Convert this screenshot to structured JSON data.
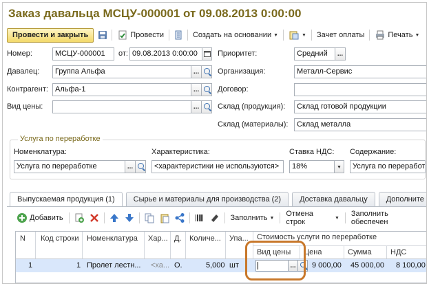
{
  "window": {
    "title": "Заказ давальца МСЦУ-000001 от 09.08.2013 0:00:00"
  },
  "toolbar": {
    "post_close": "Провести и закрыть",
    "post": "Провести",
    "create_based": "Создать на основании",
    "offset": "Зачет оплаты",
    "print": "Печать"
  },
  "form": {
    "number_label": "Номер:",
    "number_value": "МСЦУ-000001",
    "from_label": "от:",
    "date_value": "09.08.2013  0:00:00",
    "priority_label": "Приоритет:",
    "priority_value": "Средний",
    "supplier_label": "Давалец:",
    "supplier_value": "Группа Альфа",
    "org_label": "Организация:",
    "org_value": "Металл-Сервис",
    "counterparty_label": "Контрагент:",
    "counterparty_value": "Альфа-1",
    "contract_label": "Договор:",
    "contract_value": "",
    "price_type_label": "Вид цены:",
    "price_type_value": "",
    "warehouse_prod_label": "Склад (продукция):",
    "warehouse_prod_value": "Склад готовой продукции",
    "warehouse_mat_label": "Склад (материалы):",
    "warehouse_mat_value": "Склад металла"
  },
  "service": {
    "group_title": "Услуга по переработке",
    "nomenclature_label": "Номенклатура:",
    "nomenclature_value": "Услуга по переработке",
    "characteristic_label": "Характеристика:",
    "characteristic_value": "<характеристики не используются>",
    "vat_label": "Ставка НДС:",
    "vat_value": "18%",
    "content_label": "Содержание:",
    "content_value": "Услуга по переработке"
  },
  "tabs": [
    {
      "label": "Выпускаемая продукция (1)"
    },
    {
      "label": "Сырье и материалы для производства (2)"
    },
    {
      "label": "Доставка давальцу"
    },
    {
      "label": "Дополните"
    }
  ],
  "table_toolbar": {
    "add": "Добавить",
    "fill": "Заполнить",
    "cancel_rows": "Отмена строк",
    "fill_supply": "Заполнить обеспечен"
  },
  "table": {
    "headers": {
      "n": "N",
      "line_code": "Код строки",
      "nomenclature": "Номенклатура",
      "char": "Хар...",
      "d": "Д.",
      "qty": "Количе...",
      "pack": "Упа...",
      "cost_group": "Стоимость услуги по переработке",
      "price_type": "Вид цены",
      "price": "Цена",
      "sum": "Сумма",
      "vat": "НДС"
    },
    "rows": [
      {
        "n": "1",
        "line_code": "1",
        "nomenclature": "Пролет лестн...",
        "char": "<ха...",
        "d": "О.",
        "qty": "5,000",
        "pack": "шт",
        "price_type": "",
        "price": "9 000,00",
        "sum": "45 000,00",
        "vat": "8 100,00"
      }
    ]
  }
}
